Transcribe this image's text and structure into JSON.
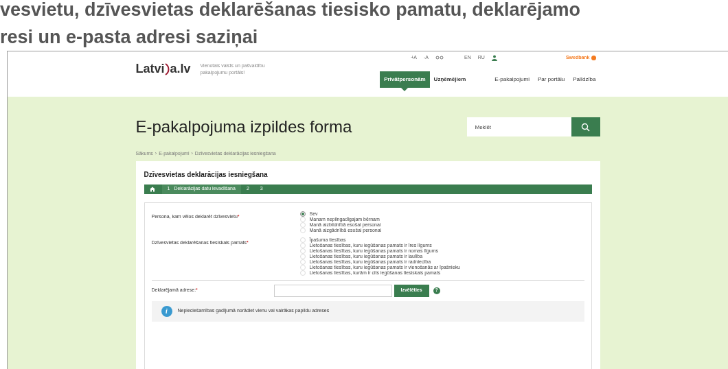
{
  "article_heading": [
    "vesvietu, dzīvesvietas deklarēšanas tiesisko pamatu, deklarējamo",
    "resi un e-pasta adresi saziņai"
  ],
  "header": {
    "logo_left": "Latvi",
    "logo_right": "a.lv",
    "tagline": "Vienotais valsts un pašvaldību pakalpojumu portāls!",
    "font_controls": [
      "+A",
      "-A"
    ],
    "languages": [
      "EN",
      "RU"
    ],
    "sponsor": "Swedbank",
    "audience_tabs": [
      {
        "label": "Privātpersonām",
        "selected": true
      },
      {
        "label": "Uzņēmējiem",
        "selected": false
      }
    ],
    "links": [
      "E-pakalpojumi",
      "Par portālu",
      "Palīdzība"
    ]
  },
  "page_title": "E-pakalpojuma izpildes forma",
  "search": {
    "placeholder": "Meklēt"
  },
  "breadcrumb": [
    "Sākums",
    "E-pakalpojumi",
    "Dzīvesvietas deklarācijas iesniegšana"
  ],
  "breadcrumb_separator": "›",
  "card": {
    "title": "Dzīvesvietas deklarācijas iesniegšana",
    "steps": [
      {
        "number": "1",
        "label": "Deklarācijas datu ievadīšana",
        "selected": true
      },
      {
        "number": "2",
        "selected": false
      },
      {
        "number": "3",
        "selected": false
      }
    ],
    "questions": [
      {
        "label": "Persona, kam vēlos deklarēt dzīvesvietu",
        "required_mark": "*",
        "options": [
          {
            "label": "Sev",
            "selected": true
          },
          {
            "label": "Manam nepilngadīgajam bērnam",
            "selected": false
          },
          {
            "label": "Manā aizbildnībā esošai personai",
            "selected": false
          },
          {
            "label": "Manā aizgādnībā esošai personai",
            "selected": false
          }
        ]
      },
      {
        "label": "Dzīvesvietas deklarēšanas tiesiskais pamats",
        "required_mark": "*",
        "options": [
          {
            "label": "Īpašuma tiesības",
            "selected": false
          },
          {
            "label": "Lietošanas tiesības, kuru iegūšanas pamats ir īres līgums",
            "selected": false
          },
          {
            "label": "Lietošanas tiesības, kuru iegūšanas pamats ir nomas līgums",
            "selected": false
          },
          {
            "label": "Lietošanas tiesības, kuru iegūšanas pamats ir laulība",
            "selected": false
          },
          {
            "label": "Lietošanas tiesības, kuru iegūšanas pamats ir radniecība",
            "selected": false
          },
          {
            "label": "Lietošanas tiesības, kuru iegūšanas pamats ir vienošanās ar īpašnieku",
            "selected": false
          },
          {
            "label": "Lietošanas tiesības, kurām ir cits iegūšanas tiesiskais pamats",
            "selected": false
          }
        ]
      }
    ],
    "address": {
      "label": "Deklarējamā adrese:",
      "required_mark": "*",
      "button": "Izvēlēties",
      "help": "?"
    },
    "info": {
      "icon": "i",
      "text": "Nepieciešamības gadījumā norādiet vienu vai vairākas papildu adreses"
    }
  }
}
